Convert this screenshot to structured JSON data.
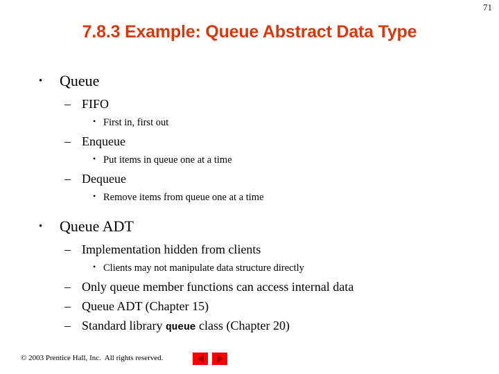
{
  "page": {
    "number": "71",
    "title": "7.8.3 Example: Queue Abstract Data Type",
    "title_color": "#d9380f",
    "background": "#ffffff"
  },
  "outline": [
    {
      "level": 1,
      "marker": "•",
      "text": "Queue"
    },
    {
      "level": 2,
      "marker": "–",
      "text": "FIFO"
    },
    {
      "level": 3,
      "marker": "•",
      "text": "First in, first out"
    },
    {
      "level": 2,
      "marker": "–",
      "text": "Enqueue"
    },
    {
      "level": 3,
      "marker": "•",
      "text": "Put items in queue one at a time"
    },
    {
      "level": 2,
      "marker": "–",
      "text": "Dequeue"
    },
    {
      "level": 3,
      "marker": "•",
      "text": "Remove items from queue one at a time"
    },
    {
      "level": 1,
      "marker": "•",
      "text": "Queue ADT"
    },
    {
      "level": 2,
      "marker": "–",
      "text": "Implementation hidden from clients"
    },
    {
      "level": 3,
      "marker": "•",
      "text": "Clients may not manipulate data structure directly"
    },
    {
      "level": 2,
      "marker": "–",
      "text": "Only queue member functions can access internal data"
    },
    {
      "level": 2,
      "marker": "–",
      "text": "Queue ADT (Chapter 15)"
    },
    {
      "level": 2,
      "marker": "–",
      "text": "Standard library queue class (Chapter 20)",
      "code_term": "queue",
      "prefix": "Standard library ",
      "suffix": " class (Chapter 20)"
    }
  ],
  "footer": {
    "copyright": "© 2003 Prentice Hall, Inc.  All rights reserved.",
    "nav": {
      "previous": {
        "icon": "triangle-left-icon",
        "label": "Previous slide"
      },
      "next": {
        "icon": "triangle-right-icon",
        "label": "Next slide"
      },
      "button_color": "#fa0000",
      "arrow_color": "#9e0000"
    }
  }
}
